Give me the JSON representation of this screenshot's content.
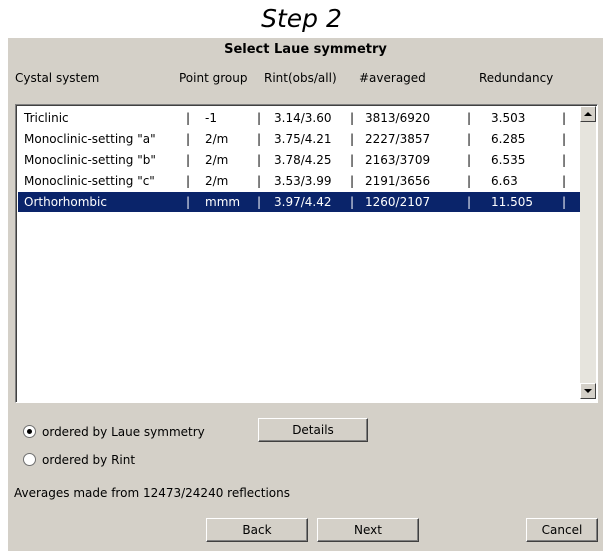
{
  "step_title": "Step 2",
  "dialog": {
    "title": "Select Laue symmetry",
    "columns": [
      "Cystal system",
      "Point group",
      "Rint(obs/all)",
      "#averaged",
      "Redundancy"
    ],
    "separator": "|",
    "rows": [
      {
        "system": "Triclinic",
        "point_group": "-1",
        "rint": "3.14/3.60",
        "averaged": "3813/6920",
        "redundancy": "3.503"
      },
      {
        "system": "Monoclinic-setting \"a\"",
        "point_group": "2/m",
        "rint": "3.75/4.21",
        "averaged": "2227/3857",
        "redundancy": "6.285"
      },
      {
        "system": "Monoclinic-setting \"b\"",
        "point_group": "2/m",
        "rint": "3.78/4.25",
        "averaged": "2163/3709",
        "redundancy": "6.535"
      },
      {
        "system": "Monoclinic-setting \"c\"",
        "point_group": "2/m",
        "rint": "3.53/3.99",
        "averaged": "2191/3656",
        "redundancy": "6.63"
      },
      {
        "system": "Orthorhombic",
        "point_group": "mmm",
        "rint": "3.97/4.42",
        "averaged": "1260/2107",
        "redundancy": "11.505"
      }
    ],
    "selected_row": "Orthorhombic",
    "radio_laue": "ordered by Laue symmetry",
    "radio_rint": "ordered by Rint",
    "details_button": "Details",
    "status": "Averages made from 12473/24240 reflections",
    "back_button": "Back",
    "next_button": "Next",
    "cancel_button": "Cancel"
  },
  "colors": {
    "dialog_bg": "#d4d0c8",
    "selection": "#0a246a"
  }
}
